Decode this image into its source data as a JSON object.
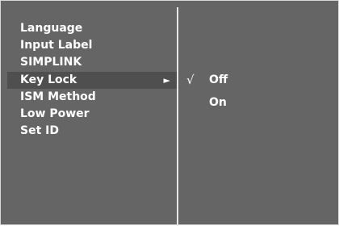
{
  "menu": {
    "items": [
      {
        "label": "Language"
      },
      {
        "label": "Input Label"
      },
      {
        "label": "SIMPLINK"
      },
      {
        "label": "Key Lock",
        "selected": true,
        "submenu_indicator": "►"
      },
      {
        "label": "ISM Method"
      },
      {
        "label": "Low Power"
      },
      {
        "label": "Set ID"
      }
    ]
  },
  "submenu": {
    "options": [
      {
        "label": "Off",
        "checked": true,
        "check_mark": "√"
      },
      {
        "label": "On",
        "checked": false
      }
    ]
  },
  "colors": {
    "panel_background": "#656565",
    "selected_row": "#4f4f4f",
    "divider": "#e6e6e6",
    "text": "#ffffff"
  }
}
